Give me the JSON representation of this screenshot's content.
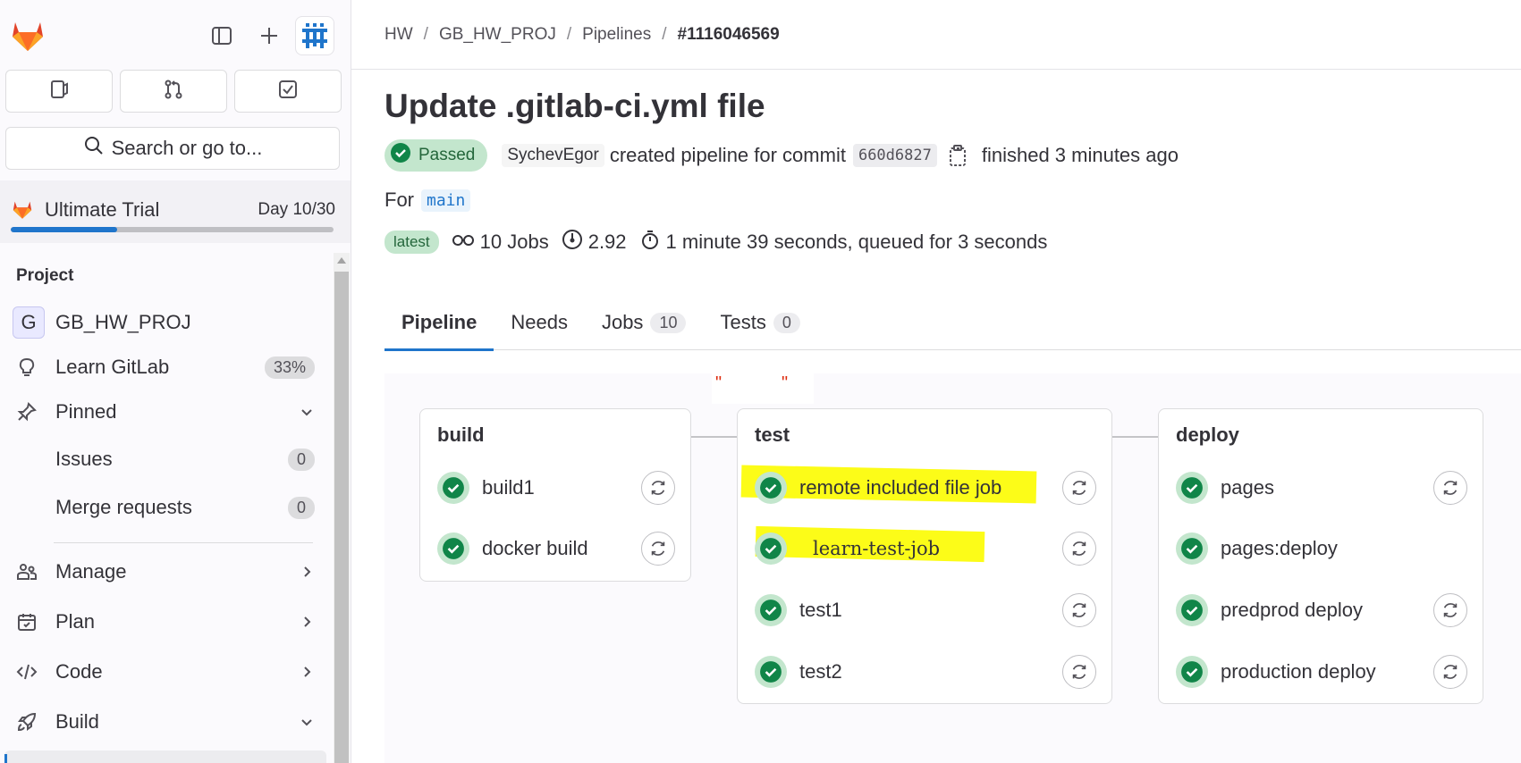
{
  "colors": {
    "brand_blue": "#1f75cb",
    "success_green": "#108548",
    "success_bg": "#c3e6cd",
    "highlight_yellow": "#fcfc18"
  },
  "sidebar": {
    "top_icons": [
      "gitlab-logo-icon",
      "sidebar-toggle-icon",
      "plus-icon",
      "avatar"
    ],
    "quick_actions": [
      "issues-icon",
      "merge-request-icon",
      "todo-icon"
    ],
    "search_placeholder": "Search or go to...",
    "trial": {
      "name": "Ultimate Trial",
      "day": "Day 10/30",
      "progress": 0.33
    },
    "section_title": "Project",
    "items": [
      {
        "key": "project",
        "icon": "G",
        "label": "GB_HW_PROJ"
      },
      {
        "key": "learn",
        "icon": "lightbulb-icon",
        "label": "Learn GitLab",
        "badge": "33%"
      },
      {
        "key": "pinned",
        "icon": "pin-icon",
        "label": "Pinned",
        "chevron": "down"
      },
      {
        "key": "issues",
        "label": "Issues",
        "badge": "0"
      },
      {
        "key": "merge-requests",
        "label": "Merge requests",
        "badge": "0"
      },
      {
        "key": "manage",
        "icon": "users-icon",
        "label": "Manage",
        "chevron": "right"
      },
      {
        "key": "plan",
        "icon": "calendar-icon",
        "label": "Plan",
        "chevron": "right"
      },
      {
        "key": "code",
        "icon": "code-icon",
        "label": "Code",
        "chevron": "right"
      },
      {
        "key": "build",
        "icon": "rocket-icon",
        "label": "Build",
        "chevron": "down"
      }
    ]
  },
  "breadcrumb": [
    "HW",
    "GB_HW_PROJ",
    "Pipelines",
    "#1116046569"
  ],
  "pipeline": {
    "title": "Update .gitlab-ci.yml file",
    "status": "Passed",
    "user": "SychevEgor",
    "created_text": "created pipeline for commit",
    "commit": "660d6827",
    "finished": "finished 3 minutes ago",
    "for_label": "For",
    "branch": "main",
    "latest": "latest",
    "jobs_count": "10 Jobs",
    "coverage": "2.92",
    "duration": "1 minute 39 seconds, queued for 3 seconds"
  },
  "tabs": [
    {
      "label": "Pipeline",
      "active": true
    },
    {
      "label": "Needs"
    },
    {
      "label": "Jobs",
      "count": "10"
    },
    {
      "label": "Tests",
      "count": "0"
    }
  ],
  "stages": [
    {
      "name": "build",
      "jobs": [
        "build1",
        "docker build"
      ]
    },
    {
      "name": "test",
      "jobs": [
        "remote included file job",
        "learn-test-job",
        "test1",
        "test2"
      ]
    },
    {
      "name": "deploy",
      "jobs": [
        "pages",
        "pages:deploy",
        "predprod deploy",
        "production deploy"
      ]
    }
  ]
}
